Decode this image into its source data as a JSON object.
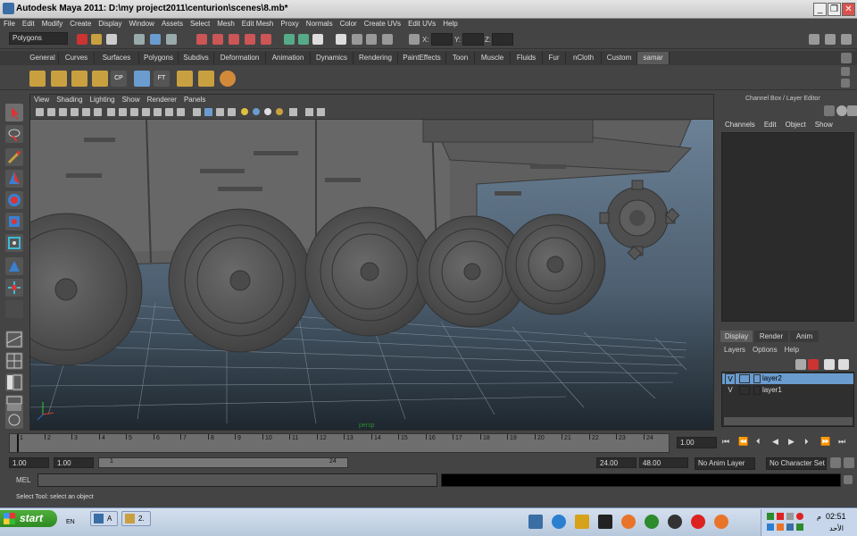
{
  "window": {
    "title": "Autodesk Maya 2011: D:\\my project2011\\centurion\\scenes\\8.mb*",
    "controls": [
      "_",
      "❐",
      "✕"
    ]
  },
  "menubar": [
    "File",
    "Edit",
    "Modify",
    "Create",
    "Display",
    "Window",
    "Assets",
    "Select",
    "Mesh",
    "Edit Mesh",
    "Proxy",
    "Normals",
    "Color",
    "Create UVs",
    "Edit UVs",
    "Help"
  ],
  "statusline": {
    "menuset": "Polygons",
    "x_label": "X:",
    "y_label": "Y:",
    "z_label": "Z:"
  },
  "shelf": {
    "tabs": [
      "General",
      "Curves",
      "Surfaces",
      "Polygons",
      "Subdivs",
      "Deformation",
      "Animation",
      "Dynamics",
      "Rendering",
      "PaintEffects",
      "Toon",
      "Muscle",
      "Fluids",
      "Fur",
      "nCloth",
      "Custom",
      "samar"
    ],
    "active_tab": "samar",
    "icons": [
      "shelf-poly-icon-1",
      "shelf-poly-icon-2",
      "shelf-poly-icon-3",
      "shelf-poly-icon-4",
      "shelf-cp-icon",
      "shelf-bend-icon",
      "shelf-ft-icon",
      "shelf-poly-icon-5",
      "shelf-poly-icon-6",
      "shelf-target-icon"
    ],
    "cp_label": "CP",
    "ft_label": "FT"
  },
  "viewport": {
    "menu": [
      "View",
      "Shading",
      "Lighting",
      "Show",
      "Renderer",
      "Panels"
    ],
    "camera_label": "persp"
  },
  "channel_box": {
    "header": "Channel Box / Layer Editor",
    "menu": [
      "Channels",
      "Edit",
      "Object",
      "Show"
    ]
  },
  "layer_editor": {
    "tabs": [
      "Display",
      "Render",
      "Anim"
    ],
    "active_tab": "Display",
    "menu": [
      "Layers",
      "Options",
      "Help"
    ],
    "layers": [
      {
        "vis": "V",
        "name": "layer2",
        "selected": true
      },
      {
        "vis": "V",
        "name": "layer1",
        "selected": false
      }
    ]
  },
  "timeline": {
    "ticks": [
      "1",
      "2",
      "3",
      "4",
      "5",
      "6",
      "7",
      "8",
      "9",
      "10",
      "11",
      "12",
      "13",
      "14",
      "15",
      "16",
      "17",
      "18",
      "19",
      "20",
      "21",
      "22",
      "23",
      "24"
    ],
    "current_frame": "1.00"
  },
  "range": {
    "start": "1.00",
    "playback_start": "1.00",
    "slider_start": "1",
    "slider_end": "24",
    "playback_end": "24.00",
    "end": "48.00",
    "anim_layer": "No Anim Layer",
    "character_set": "No Character Set"
  },
  "mel": {
    "label": "MEL"
  },
  "helpline": "Select Tool: select an object",
  "taskbar": {
    "start_label": "start",
    "lang": "EN",
    "tasks": [
      {
        "label": "A"
      },
      {
        "label": "2."
      }
    ],
    "clock": "02:51",
    "ampm": "م",
    "day": "الأحد"
  },
  "colors": {
    "accent_select": "#6a9ccf",
    "viewport_bg_top": "#6a7f93",
    "viewport_bg_bottom": "#1f2830"
  }
}
